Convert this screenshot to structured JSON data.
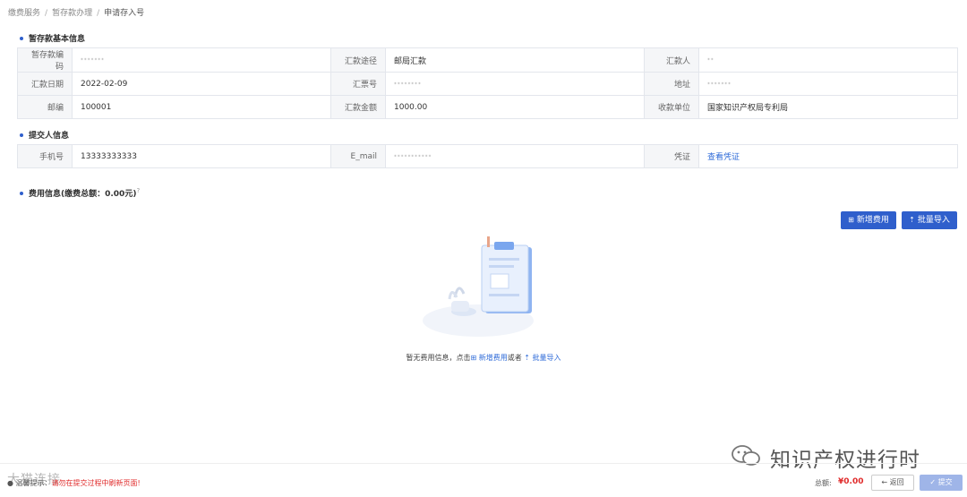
{
  "breadcrumb": {
    "items": [
      "缴费服务",
      "暂存款办理",
      "申请存入号"
    ]
  },
  "sections": {
    "basic_title": "暂存款基本信息",
    "submitter_title": "提交人信息",
    "fee_title": "费用信息(缴费总额：0.00元)",
    "fee_sup": "?"
  },
  "basic": {
    "r1": {
      "l1": "暂存款编码",
      "v1": "·······",
      "l2": "汇款途径",
      "v2": "邮局汇款",
      "l3": "汇款人",
      "v3": "··"
    },
    "r2": {
      "l1": "汇款日期",
      "v1": "2022-02-09",
      "l2": "汇票号",
      "v2": "········",
      "l3": "地址",
      "v3": "·······"
    },
    "r3": {
      "l1": "邮编",
      "v1": "100001",
      "l2": "汇款金额",
      "v2": "1000.00",
      "l3": "收款单位",
      "v3": "国家知识产权局专利局"
    }
  },
  "submitter": {
    "l1": "手机号",
    "v1": "13333333333",
    "l2": "E_mail",
    "v2": "···········",
    "l3": "凭证",
    "v3": "查看凭证"
  },
  "buttons": {
    "add_fee": "新增费用",
    "batch_import": "批量导入",
    "back": "返回",
    "submit": "提交"
  },
  "empty": {
    "prefix": "暂无费用信息，点击",
    "link1": "新增费用",
    "mid": "或者",
    "link2": "批量导入"
  },
  "footer": {
    "tip_prefix": "温馨提示：",
    "tip_red": "请勿在提交过程中刷新页面!",
    "total_label": "总额:",
    "total_value": "¥0.00",
    "watermark": "大猫连接"
  },
  "watermark": {
    "text": "知识产权进行时"
  },
  "colors": {
    "primary": "#2f5fcc",
    "link": "#2f6bd8",
    "danger": "#e02b2b"
  }
}
